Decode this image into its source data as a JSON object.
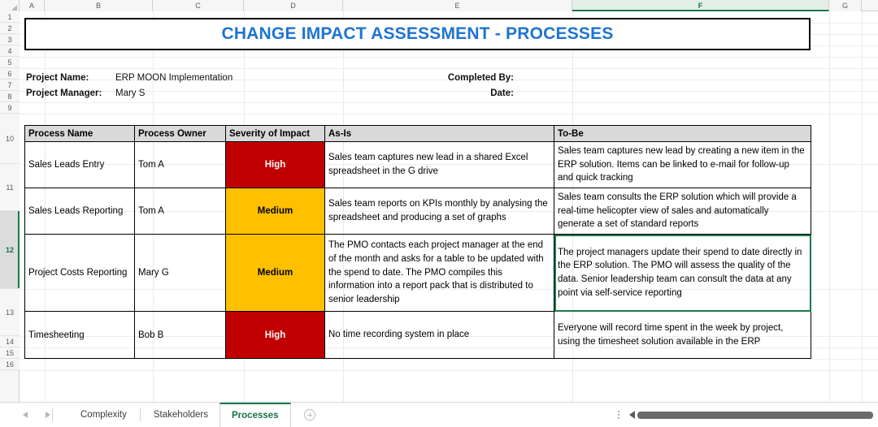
{
  "spreadsheet": {
    "column_headers": [
      "A",
      "B",
      "C",
      "D",
      "E",
      "F",
      "G"
    ],
    "selected_column": "F",
    "row_headers": [
      "1",
      "2",
      "3",
      "4",
      "5",
      "6",
      "7",
      "8",
      "9",
      "10",
      "11",
      "12",
      "13",
      "14",
      "15",
      "16"
    ],
    "selected_row": "12"
  },
  "title": "CHANGE IMPACT ASSESSMENT - PROCESSES",
  "title_color": "#1f74d0",
  "info": {
    "project_name_label": "Project Name:",
    "project_name_value": "ERP MOON Implementation",
    "project_manager_label": "Project Manager:",
    "project_manager_value": "Mary S",
    "completed_by_label": "Completed By:",
    "completed_by_value": "",
    "date_label": "Date:",
    "date_value": ""
  },
  "table": {
    "headers": [
      "Process Name",
      "Process Owner",
      "Severity of Impact",
      "As-Is",
      "To-Be"
    ],
    "rows": [
      {
        "process_name": "Sales Leads Entry",
        "process_owner": "Tom A",
        "severity": "High",
        "severity_level": "high",
        "as_is": "Sales team captures new lead in a shared Excel spreadsheet in the G drive",
        "to_be": "Sales team captures new lead by creating a new item in the ERP solution. Items can be linked to e-mail for follow-up and quick tracking",
        "selected": false
      },
      {
        "process_name": "Sales Leads Reporting",
        "process_owner": "Tom A",
        "severity": "Medium",
        "severity_level": "medium",
        "as_is": "Sales team reports on KPIs monthly by analysing the spreadsheet and producing a set of graphs",
        "to_be": "Sales team consults the ERP solution which will provide a real-time helicopter view of sales and automatically generate a set of standard reports",
        "selected": false
      },
      {
        "process_name": "Project Costs Reporting",
        "process_owner": "Mary G",
        "severity": "Medium",
        "severity_level": "medium",
        "as_is": "The PMO contacts each project manager at the end of the month and asks for a table to be updated with the spend to date. The PMO compiles this information into a report pack that is distributed to senior leadership",
        "to_be": "The project managers update their spend to date directly in the ERP solution. The PMO will assess the quality of the data. Senior leadership team can consult the data at any point via self-service reporting",
        "selected": true
      },
      {
        "process_name": "Timesheeting",
        "process_owner": "Bob B",
        "severity": "High",
        "severity_level": "high",
        "as_is": "No time recording system in place",
        "to_be": "Everyone will record time spent in the week by project, using the timesheet solution available in the ERP",
        "selected": false
      }
    ]
  },
  "severity_colors": {
    "high_bg": "#c00000",
    "high_text": "#ffffff",
    "medium_bg": "#ffc000",
    "medium_text": "#000000"
  },
  "sheet_tabs": {
    "tabs": [
      {
        "label": "Complexity",
        "active": false
      },
      {
        "label": "Stakeholders",
        "active": false
      },
      {
        "label": "Processes",
        "active": true
      }
    ],
    "add_sheet_icon": "plus-circle-icon",
    "prev_icon": "left-arrow-icon",
    "next_icon": "right-arrow-icon",
    "active_tab_color": "#157347"
  }
}
